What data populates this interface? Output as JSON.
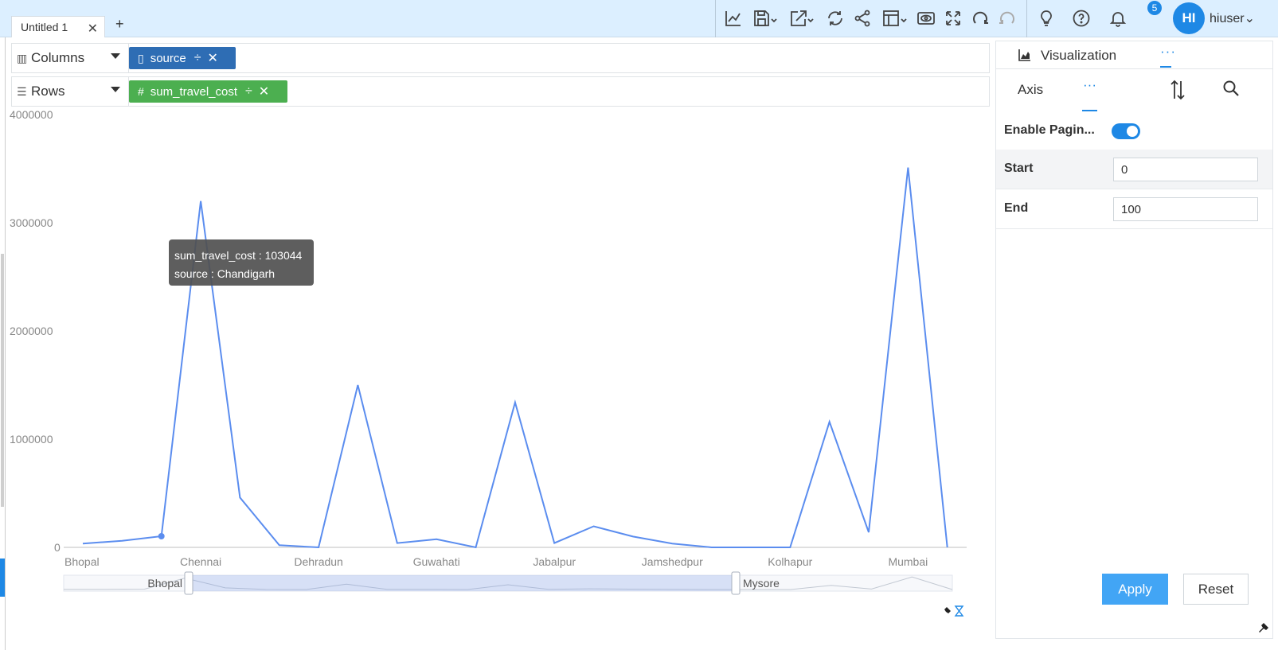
{
  "tabs": {
    "active_label": "Untitled 1",
    "add_label": "+"
  },
  "toolbar": {
    "icons": [
      "line-chart-icon",
      "save-icon",
      "export-icon",
      "refresh-icon",
      "share-icon",
      "layout-icon",
      "preview-icon",
      "fullscreen-icon",
      "undo-icon",
      "redo-icon",
      "lightbulb-icon",
      "help-icon",
      "bell-icon"
    ],
    "notification_count": "5",
    "avatar_initials": "HI",
    "username": "hiuser"
  },
  "shelves": {
    "columns": {
      "label": "Columns",
      "pill": "source"
    },
    "rows": {
      "label": "Rows",
      "pill": "sum_travel_cost"
    }
  },
  "colors": {
    "accent": "#1e88e5",
    "columns_pill": "#2e6db4",
    "rows_pill": "#4caf50",
    "line": "#5b8def"
  },
  "chart_data": {
    "type": "line",
    "x_labels": [
      "Bhopal",
      "Chennai",
      "Dehradun",
      "Guwahati",
      "Jabalpur",
      "Jamshedpur",
      "Kolhapur",
      "Mumbai"
    ],
    "yticks": [
      "0",
      "1000000",
      "2000000",
      "3000000",
      "4000000"
    ],
    "ylim": [
      0,
      4000000
    ],
    "values": [
      35000,
      60000,
      103044,
      3200000,
      460000,
      20000,
      0,
      1500000,
      40000,
      75000,
      0,
      1340000,
      40000,
      195000,
      100000,
      35000,
      0,
      0,
      0,
      1160000,
      140000,
      3510000,
      0
    ],
    "highlight_index": 2,
    "tooltip": {
      "value_line": "sum_travel_cost : 103044",
      "source_line": "source : Chandigarh"
    },
    "zoom": {
      "start_label": "Bhopal",
      "end_label": "Mysore"
    }
  },
  "panel": {
    "header_label": "Visualization",
    "header_dots": "···",
    "subtab_axis": "Axis",
    "subtab_dots": "···",
    "enable_pagination_label": "Enable Pagin...",
    "start_label": "Start",
    "start_value": "0",
    "end_label": "End",
    "end_value": "100",
    "apply_label": "Apply",
    "reset_label": "Reset"
  }
}
